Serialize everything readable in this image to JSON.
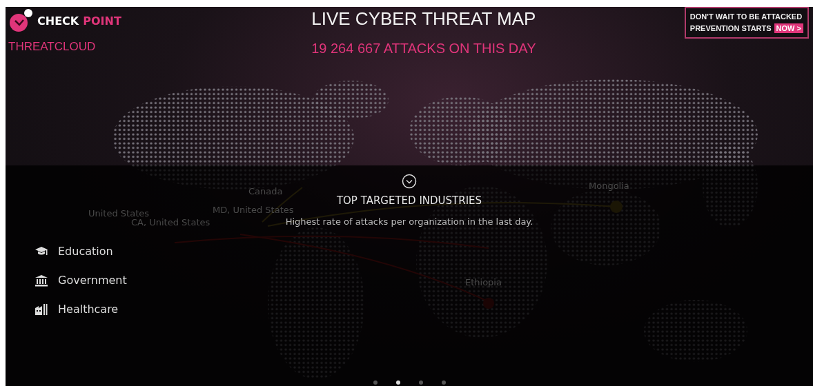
{
  "logo": {
    "brand_1": "CHECK",
    "brand_2": "POINT",
    "product": "THREATCLOUD"
  },
  "title": "LIVE CYBER THREAT MAP",
  "attack_count": "19 264 667 ATTACKS ON THIS DAY",
  "promo": {
    "line_1": "DON'T WAIT TO BE ATTACKED",
    "line_2": "PREVENTION STARTS",
    "button": "NOW >"
  },
  "map_labels": [
    "Canada",
    "MD, United States",
    "United States",
    "CA, United States",
    "Mongolia",
    "Ethiopia"
  ],
  "panel": {
    "title": "TOP TARGETED INDUSTRIES",
    "subtitle": "Highest rate of attacks per organization in the last day.",
    "industries": [
      {
        "kind": "education",
        "label": "Education"
      },
      {
        "kind": "government",
        "label": "Government"
      },
      {
        "kind": "healthcare",
        "label": "Healthcare"
      }
    ]
  },
  "pager": [
    {
      "selected": false
    },
    {
      "selected": true
    },
    {
      "selected": false
    },
    {
      "selected": false
    }
  ]
}
